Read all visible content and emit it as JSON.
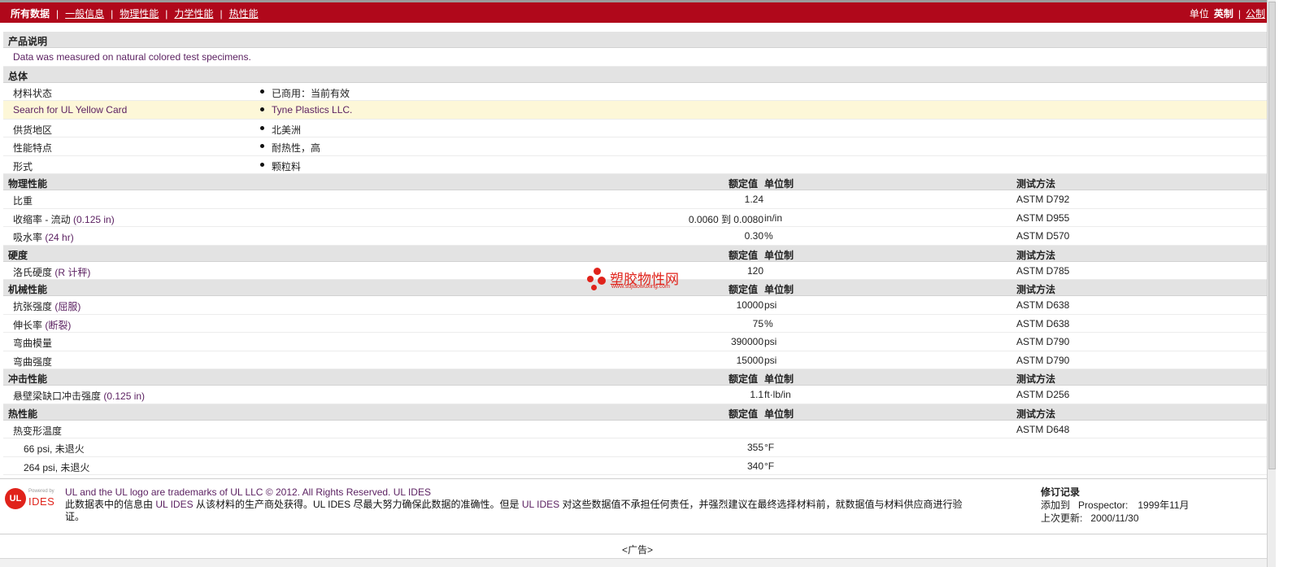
{
  "nav": {
    "items": [
      "所有数据",
      "一般信息",
      "物理性能",
      "力学性能",
      "热性能"
    ],
    "separator": "|",
    "units_label": "单位",
    "units_active": "英制",
    "units_other": "公制"
  },
  "description": {
    "header": "产品说明",
    "text": "Data was measured on natural colored test specimens."
  },
  "general": {
    "header": "总体",
    "rows": [
      {
        "name": "材料状态",
        "value": "已商用：当前有效"
      },
      {
        "name": "Search for UL Yellow Card",
        "value": "Tyne Plastics LLC."
      },
      {
        "name": "供货地区",
        "value": "北美洲"
      },
      {
        "name": "性能特点",
        "value": "耐热性，高"
      },
      {
        "name": "形式",
        "value": "颗粒料"
      }
    ]
  },
  "col_headers": {
    "nominal": "额定值",
    "unit": "单位制",
    "method": "测试方法"
  },
  "physical": {
    "header": "物理性能",
    "rows": [
      {
        "name": "比重",
        "cond": "",
        "value": "1.24",
        "unit": "",
        "method": "ASTM D792"
      },
      {
        "name": "收缩率 - 流动",
        "cond": "(0.125 in)",
        "value": "0.0060 到  0.0080",
        "unit": "in/in",
        "method": "ASTM D955"
      },
      {
        "name": "吸水率",
        "cond": "(24 hr)",
        "value": "0.30",
        "unit": "%",
        "method": "ASTM D570"
      }
    ]
  },
  "hardness": {
    "header": "硬度",
    "rows": [
      {
        "name": "洛氏硬度",
        "cond": "(R 计秤)",
        "value": "120",
        "unit": "",
        "method": "ASTM D785"
      }
    ]
  },
  "mechanical": {
    "header": "机械性能",
    "rows": [
      {
        "name": "抗张强度",
        "cond": "(屈服)",
        "value": "10000",
        "unit": "psi",
        "method": "ASTM D638"
      },
      {
        "name": "伸长率",
        "cond": "(断裂)",
        "value": "75",
        "unit": "%",
        "method": "ASTM D638"
      },
      {
        "name": "弯曲模量",
        "cond": "",
        "value": "390000",
        "unit": "psi",
        "method": "ASTM D790"
      },
      {
        "name": "弯曲强度",
        "cond": "",
        "value": "15000",
        "unit": "psi",
        "method": "ASTM D790"
      }
    ]
  },
  "impact": {
    "header": "冲击性能",
    "rows": [
      {
        "name": "悬壁梁缺口冲击强度",
        "cond": "(0.125 in)",
        "value": "1.1",
        "unit": "ft·lb/in",
        "method": "ASTM D256"
      }
    ]
  },
  "thermal": {
    "header": "热性能",
    "rows": [
      {
        "name": "热变形温度",
        "value": "",
        "unit": "",
        "method": "ASTM D648"
      },
      {
        "name": "66 psi, 未退火",
        "value": "355",
        "unit": "°F",
        "method": ""
      },
      {
        "name": "264 psi, 未退火",
        "value": "340",
        "unit": "°F",
        "method": ""
      }
    ]
  },
  "watermark": {
    "title": "塑胶物性网",
    "url": "www.sujiaowuxing.com"
  },
  "footer": {
    "logo_powered": "Powered by",
    "logo_ul": "UL",
    "logo_ides": "IDES",
    "line1": "UL and the UL logo are trademarks of UL LLC © 2012. All Rights Reserved. UL IDES",
    "line2_a": "此数据表中的信息由",
    "line2_b": "UL IDES",
    "line2_c": "从该材料的生产商处获得。UL IDES 尽最大努力确保此数据的准确性。但是",
    "line2_d": "UL IDES",
    "line2_e": "对这些数据值不承担任何责任，并强烈建议在最终选择材料前，就数据值与材料供应商进行验",
    "line3": "证。",
    "revision_title": "修订记录",
    "added_label": "添加到",
    "added_where": "Prospector:",
    "added_date": "1999年11月",
    "updated_label": "上次更新:",
    "updated_date": "2000/11/30"
  },
  "ad_label": "<广告>"
}
